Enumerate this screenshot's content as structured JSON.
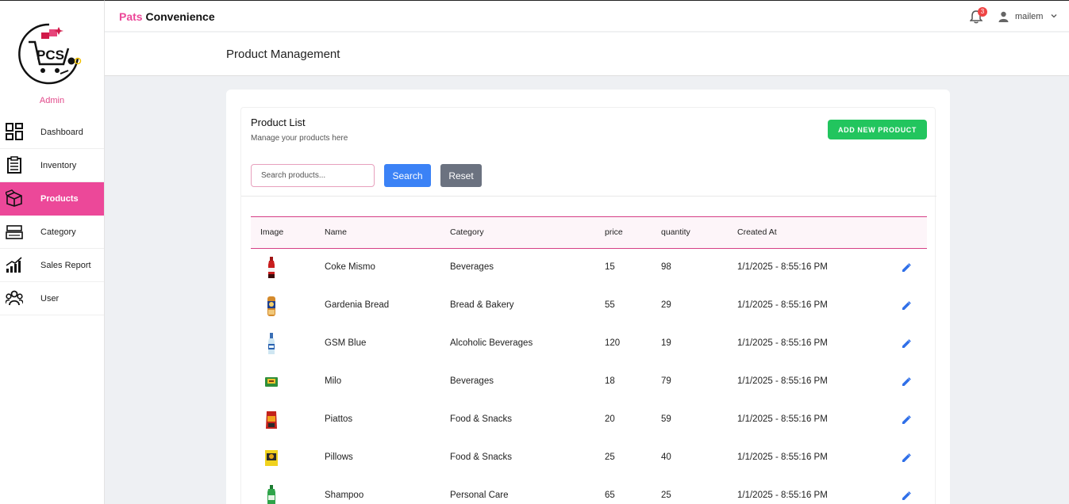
{
  "sidebar": {
    "role": "Admin",
    "items": [
      {
        "label": "Dashboard",
        "icon": "dashboard-grid-icon",
        "active": false
      },
      {
        "label": "Inventory",
        "icon": "clipboard-icon",
        "active": false
      },
      {
        "label": "Products",
        "icon": "box-icon",
        "active": true
      },
      {
        "label": "Category",
        "icon": "tray-icon",
        "active": false
      },
      {
        "label": "Sales Report",
        "icon": "bar-chart-icon",
        "active": false
      },
      {
        "label": "User",
        "icon": "users-icon",
        "active": false
      }
    ]
  },
  "topbar": {
    "brand_accent": "Pats",
    "brand_rest": " Convenience",
    "notification_count": "3",
    "username": "mailem"
  },
  "page": {
    "title": "Product Management"
  },
  "product_list": {
    "title": "Product List",
    "subtitle": "Manage your products here",
    "add_button": "ADD NEW PRODUCT",
    "search_placeholder": "Search products...",
    "search_button": "Search",
    "reset_button": "Reset"
  },
  "table": {
    "headers": {
      "image": "Image",
      "name": "Name",
      "category": "Category",
      "price": "price",
      "quantity": "quantity",
      "created_at": "Created At"
    },
    "rows": [
      {
        "name": "Coke Mismo",
        "category": "Beverages",
        "price": "15",
        "quantity": "98",
        "created_at": "1/1/2025 - 8:55:16 PM",
        "thumb": "coke-bottle-image"
      },
      {
        "name": "Gardenia Bread",
        "category": "Bread & Bakery",
        "price": "55",
        "quantity": "29",
        "created_at": "1/1/2025 - 8:55:16 PM",
        "thumb": "bread-image"
      },
      {
        "name": "GSM Blue",
        "category": "Alcoholic Beverages",
        "price": "120",
        "quantity": "19",
        "created_at": "1/1/2025 - 8:55:16 PM",
        "thumb": "gin-bottle-image"
      },
      {
        "name": "Milo",
        "category": "Beverages",
        "price": "18",
        "quantity": "79",
        "created_at": "1/1/2025 - 8:55:16 PM",
        "thumb": "milo-sachet-image"
      },
      {
        "name": "Piattos",
        "category": "Food & Snacks",
        "price": "20",
        "quantity": "59",
        "created_at": "1/1/2025 - 8:55:16 PM",
        "thumb": "chips-bag-image"
      },
      {
        "name": "Pillows",
        "category": "Food & Snacks",
        "price": "25",
        "quantity": "40",
        "created_at": "1/1/2025 - 8:55:16 PM",
        "thumb": "snack-bag-image"
      },
      {
        "name": "Shampoo",
        "category": "Personal Care",
        "price": "65",
        "quantity": "25",
        "created_at": "1/1/2025 - 8:55:16 PM",
        "thumb": "shampoo-bottle-image"
      }
    ]
  },
  "colors": {
    "accent_pink": "#ec4899",
    "add_green": "#22c55e",
    "search_blue": "#3b82f6",
    "reset_gray": "#6b7280",
    "badge_red": "#ef4444"
  }
}
